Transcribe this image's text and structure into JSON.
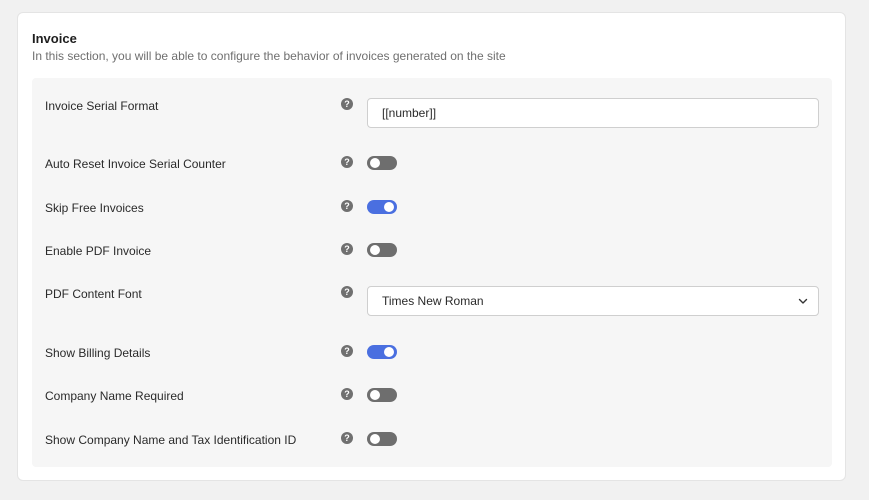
{
  "section": {
    "title": "Invoice",
    "description": "In this section, you will be able to configure the behavior of invoices generated on the site"
  },
  "settings": [
    {
      "label": "Invoice Serial Format",
      "control": "text",
      "value": "[[number]]"
    },
    {
      "label": "Auto Reset Invoice Serial Counter",
      "control": "toggle",
      "on": false
    },
    {
      "label": "Skip Free Invoices",
      "control": "toggle",
      "on": true
    },
    {
      "label": "Enable PDF Invoice",
      "control": "toggle",
      "on": false
    },
    {
      "label": "PDF Content Font",
      "control": "select",
      "value": "Times New Roman"
    },
    {
      "label": "Show Billing Details",
      "control": "toggle",
      "on": true
    },
    {
      "label": "Company Name Required",
      "control": "toggle",
      "on": false
    },
    {
      "label": "Show Company Name and Tax Identification ID",
      "control": "toggle",
      "on": false
    }
  ],
  "help_glyph": "?",
  "icons": {
    "help": "question-circle-icon",
    "select_arrow": "chevron-down-icon"
  },
  "colors": {
    "toggle_on": "#4a6fe0",
    "toggle_off": "#6e6e6e",
    "panel_bg": "#f6f6f6"
  }
}
